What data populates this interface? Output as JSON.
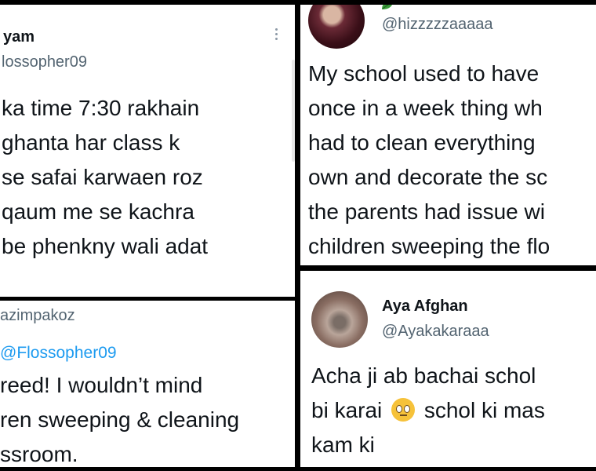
{
  "tweets": {
    "top_left": {
      "name": "yam",
      "handle": "lossopher09",
      "body_lines": [
        "ka time 7:30 rakhain",
        " ghanta har class k",
        "se safai karwaen roz",
        "qaum me se kachra",
        "be phenkny wali adat"
      ]
    },
    "top_right": {
      "handle": "@hizzzzzaaaaa",
      "body_lines": [
        "My school used to have",
        "once in a week thing wh",
        "had to clean everything",
        "own and decorate the sc",
        "the parents had issue wi",
        "children sweeping the flo"
      ]
    },
    "bottom_left": {
      "handle": "azimpakoz",
      "reply_to": "@Flossopher09",
      "body_lines": [
        "reed! I wouldn’t mind",
        "ren sweeping & cleaning",
        "ssroom."
      ]
    },
    "bottom_right": {
      "name": "Aya Afghan",
      "handle": "@Ayakakaraaa",
      "body_line1": "Acha ji ab bachai schol",
      "body_line2_before": "bi karai",
      "body_line2_after": " schol ki mas",
      "body_line3": "kam ki"
    }
  },
  "colors": {
    "link": "#1d9bf0",
    "secondary_text": "#536471",
    "divider": "#000000"
  },
  "icons": [
    "more-options-icon",
    "leaf-emoji-icon",
    "rolling-eyes-emoji-icon"
  ]
}
